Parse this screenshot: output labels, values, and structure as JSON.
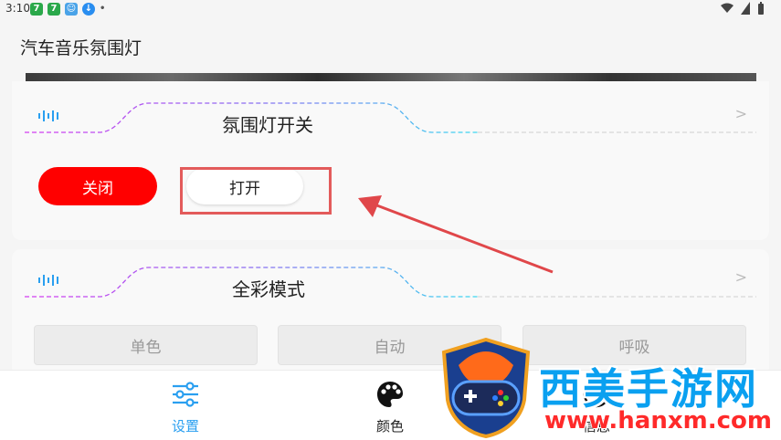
{
  "status_bar": {
    "time": "3:10"
  },
  "app": {
    "title": "汽车音乐氛围灯"
  },
  "power_card": {
    "title": "氛围灯开关",
    "off_label": "关闭",
    "on_label": "打开",
    "chevron": ">"
  },
  "mode_card": {
    "title": "全彩模式",
    "chevron": ">",
    "options": [
      "单色",
      "自动",
      "呼吸"
    ]
  },
  "nav": {
    "items": [
      {
        "label": "设置",
        "icon": "sliders-icon",
        "active": true
      },
      {
        "label": "颜色",
        "icon": "palette-icon",
        "active": false
      },
      {
        "label": "信息",
        "icon": "info-icon",
        "active": false
      }
    ]
  },
  "watermark": {
    "brand": "西美手游网",
    "url": "www.hanxm.com"
  },
  "colors": {
    "accent": "#2a9ff0",
    "off_button": "#ff0000",
    "highlight": "#e35b5b",
    "gradient_start": "#d43cf0",
    "gradient_end": "#3cd8f0"
  }
}
